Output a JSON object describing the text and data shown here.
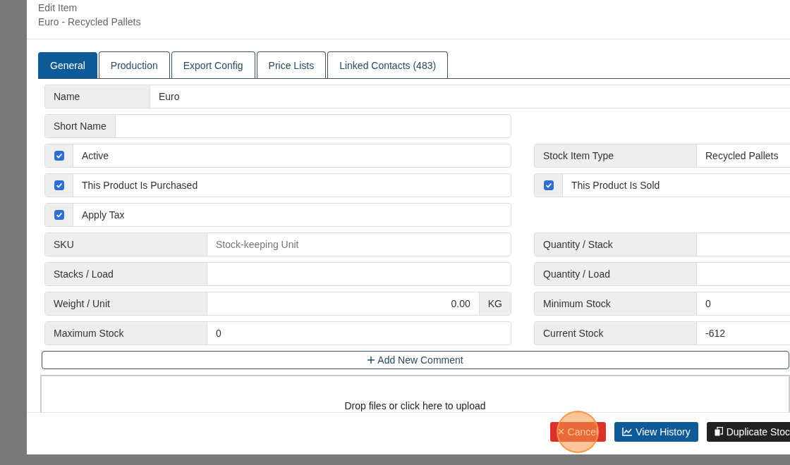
{
  "header": {
    "title": "Edit Item",
    "subtitle": "Euro - Recycled Pallets"
  },
  "tabs": [
    {
      "label": "General",
      "selected": true
    },
    {
      "label": "Production",
      "selected": false
    },
    {
      "label": "Export Config",
      "selected": false
    },
    {
      "label": "Price Lists",
      "selected": false
    },
    {
      "label": "Linked Contacts (483)",
      "selected": false
    }
  ],
  "name_row": {
    "label": "Name",
    "value": "Euro"
  },
  "rows": [
    {
      "left": {
        "kind": "inline",
        "label": "Short Name"
      },
      "right": null
    },
    {
      "left": {
        "kind": "check",
        "label": "Active",
        "checked": true
      },
      "right": {
        "kind": "text",
        "label": "Stock Item Type",
        "value": "Recycled Pallets"
      }
    },
    {
      "left": {
        "kind": "check",
        "label": "This Product Is Purchased",
        "checked": true
      },
      "right": {
        "kind": "check",
        "label": "This Product Is Sold",
        "checked": true
      }
    },
    {
      "left": {
        "kind": "check",
        "label": "Apply Tax",
        "checked": true
      },
      "right": null
    },
    {
      "left": {
        "kind": "text",
        "label": "SKU",
        "placeholder": "Stock-keeping Unit"
      },
      "right": {
        "kind": "text",
        "label": "Quantity / Stack"
      }
    },
    {
      "left": {
        "kind": "text",
        "label": "Stacks / Load"
      },
      "right": {
        "kind": "text",
        "label": "Quantity / Load"
      }
    },
    {
      "left": {
        "kind": "text",
        "label": "Weight / Unit",
        "value": "0.00",
        "unit": "KG"
      },
      "right": {
        "kind": "text",
        "label": "Minimum Stock",
        "value": "0"
      }
    },
    {
      "left": {
        "kind": "text",
        "label": "Maximum Stock",
        "value": "0"
      },
      "right": {
        "kind": "text",
        "label": "Current Stock",
        "value": "-612"
      }
    }
  ],
  "add_comment": {
    "label": "Add New Comment"
  },
  "dropzone": {
    "text": "Drop files or click here to upload"
  },
  "buttons": [
    {
      "kind": "danger",
      "label": "Cancel",
      "highlighted": true
    },
    {
      "kind": "primary",
      "label": "View History",
      "highlighted": false
    },
    {
      "kind": "dark",
      "label": "Duplicate Stoc",
      "highlighted": false
    }
  ]
}
